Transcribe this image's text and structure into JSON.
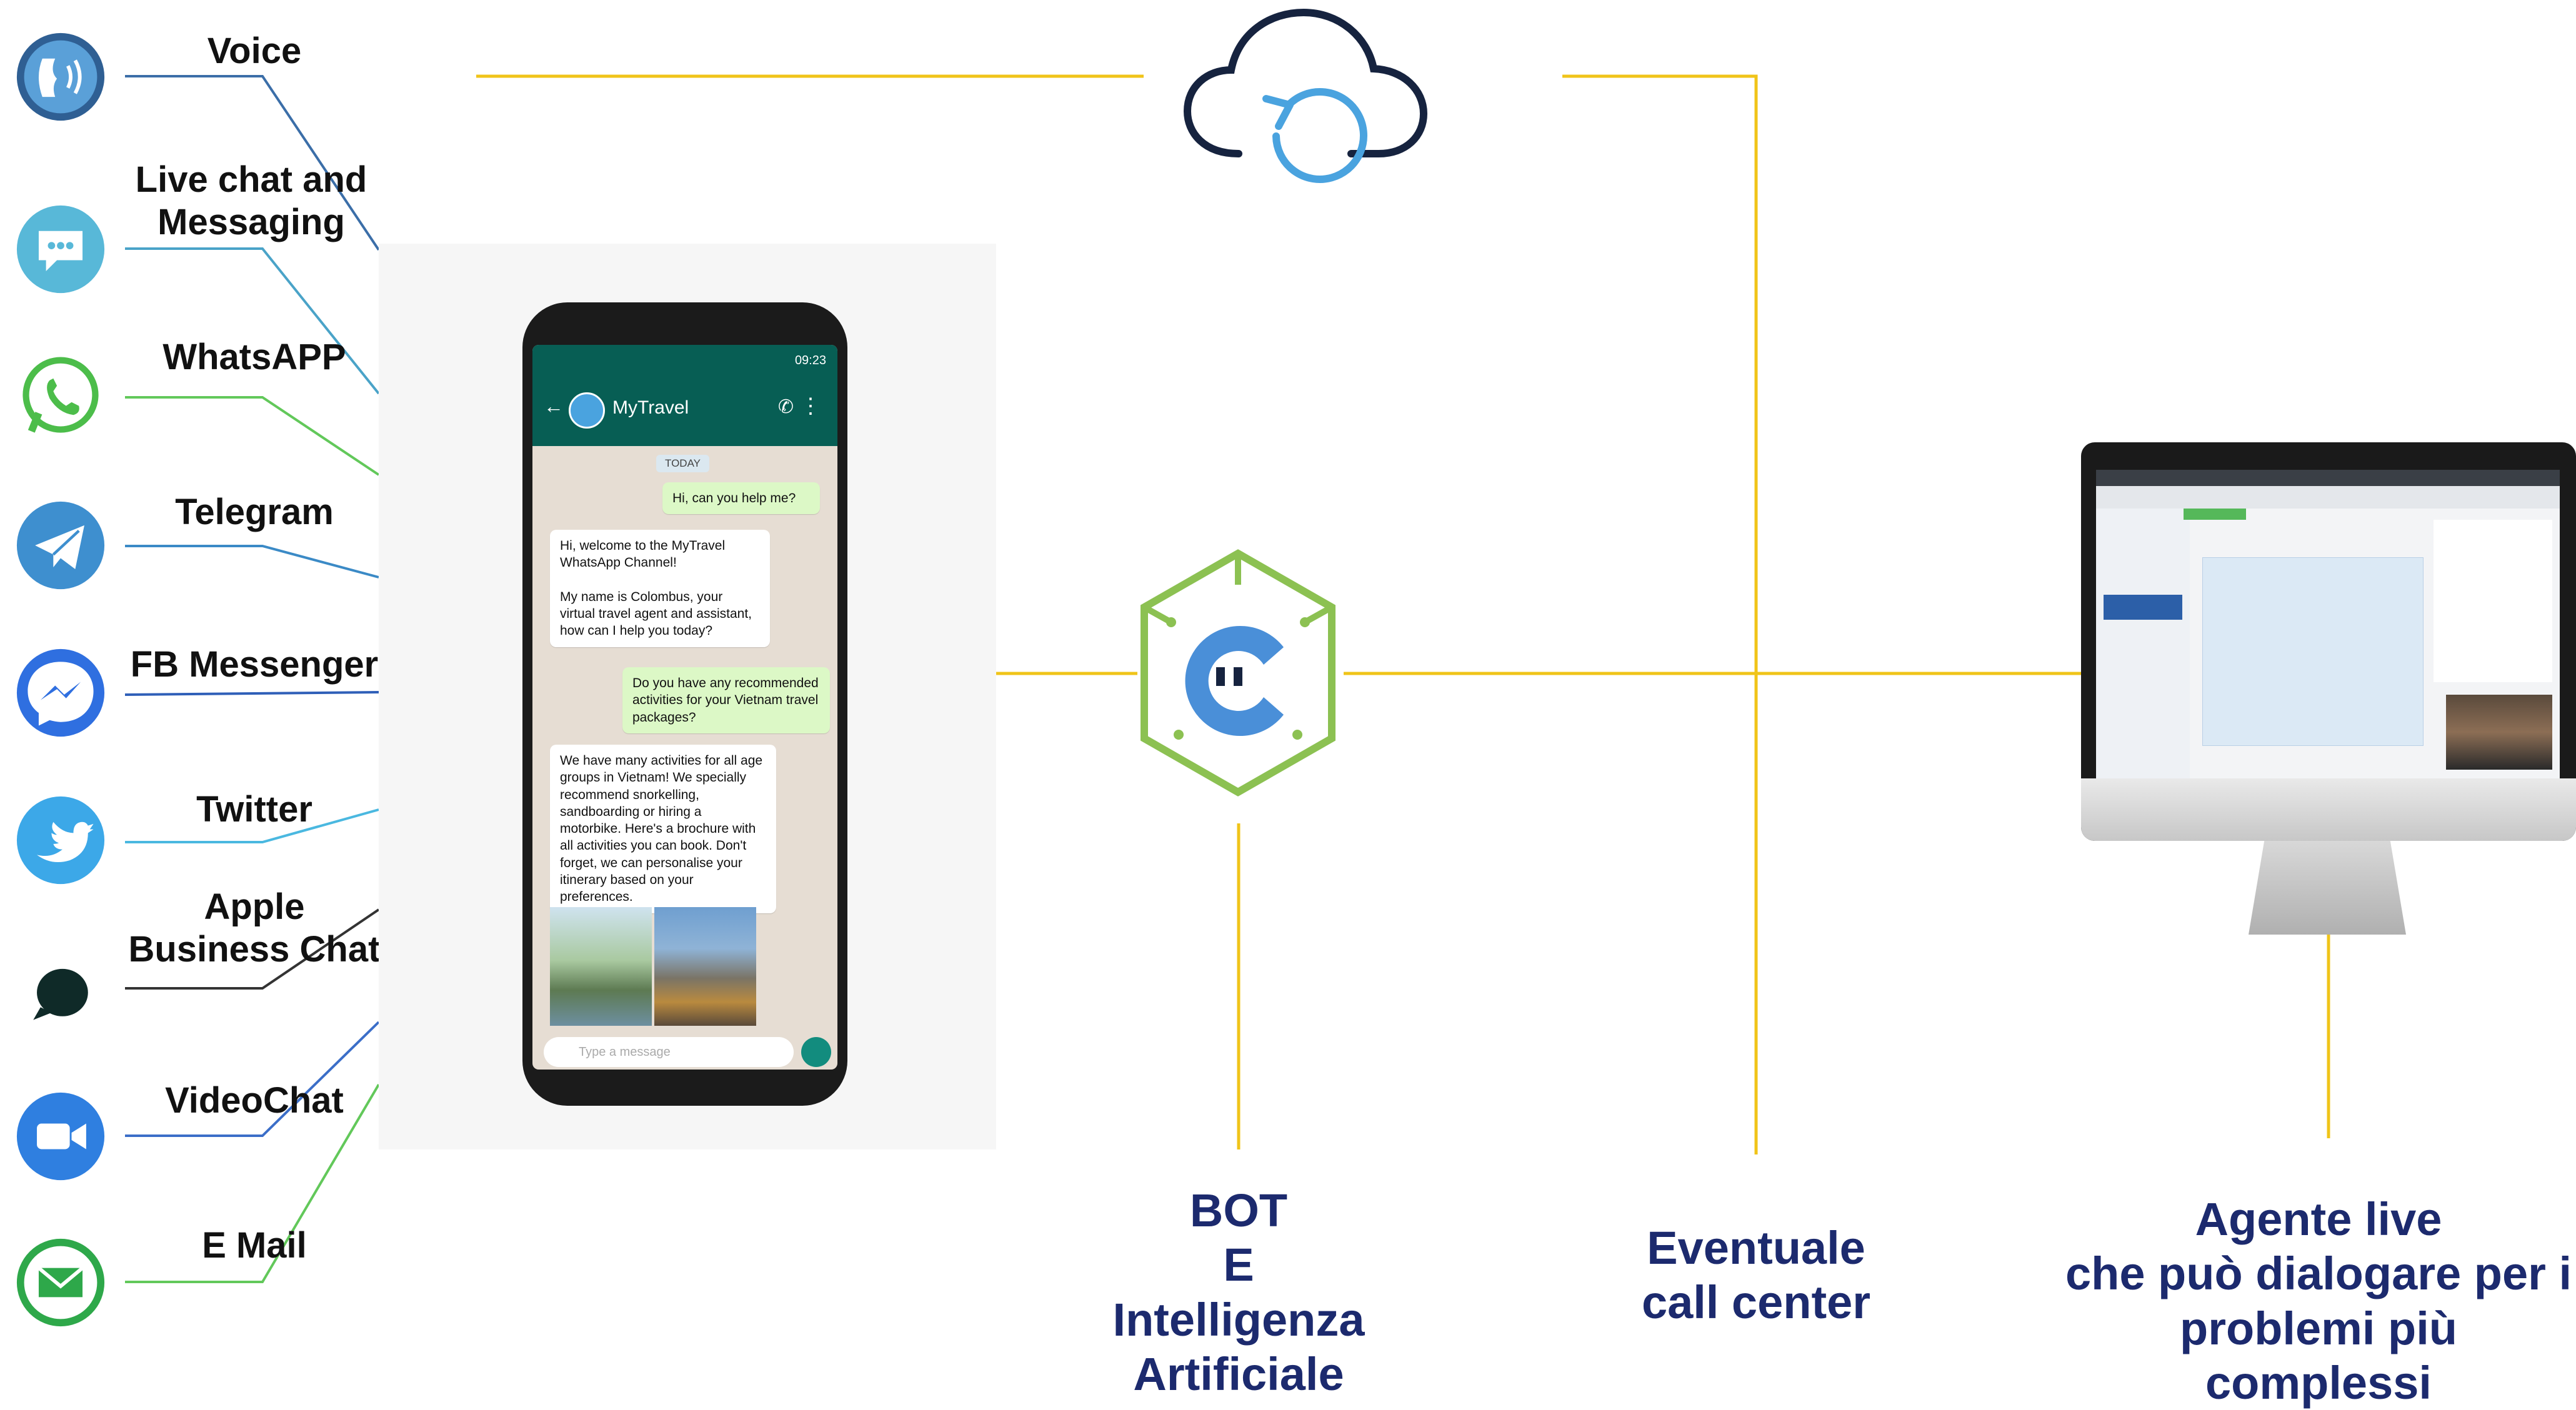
{
  "channels": [
    {
      "label": "Voice",
      "icon": "voice-icon"
    },
    {
      "label": "Live chat and Messaging",
      "icon": "chat-bubble-icon"
    },
    {
      "label": "WhatsAPP",
      "icon": "whatsapp-icon"
    },
    {
      "label": "Telegram",
      "icon": "telegram-icon"
    },
    {
      "label": "FB Messenger",
      "icon": "messenger-icon"
    },
    {
      "label": "Twitter",
      "icon": "twitter-icon"
    },
    {
      "label": "Apple Business Chat",
      "icon": "apple-business-chat-icon"
    },
    {
      "label": "VideoChat",
      "icon": "video-camera-icon"
    },
    {
      "label": "E Mail",
      "icon": "email-icon"
    }
  ],
  "nodes": {
    "bot": {
      "line1": "BOT",
      "line2": "E",
      "line3": "Intelligenza",
      "line4": "Artificiale"
    },
    "call_center": {
      "line1": "Eventuale",
      "line2": "call center"
    },
    "agent": {
      "line1": "Agente live",
      "line2": "che può dialogare per i",
      "line3": "problemi più complessi"
    }
  },
  "phone": {
    "time": "09:23",
    "app_name": "MyTravel",
    "date_divider": "TODAY",
    "messages": [
      {
        "dir": "out",
        "text": "Hi, can you help me?"
      },
      {
        "dir": "in",
        "text": "Hi, welcome to the MyTravel WhatsApp Channel!\n\nMy name is Colombus, your virtual travel agent and assistant, how can I help you today?"
      },
      {
        "dir": "out",
        "text": "Do you have any recommended activities for your Vietnam travel packages?"
      },
      {
        "dir": "in",
        "text": "We have many activities for all age groups in Vietnam! We specially recommend snorkelling, sandboarding or hiring a motorbike. Here's a brochure with all activities you can book. Don't forget, we can personalise your itinerary based on your preferences."
      }
    ],
    "input_placeholder": "Type a message"
  },
  "colors": {
    "connector": "#f0c419",
    "label_blue": "#1c2a6e",
    "logo_green": "#8cc152",
    "logo_blue": "#4a8fd8",
    "cloud_dark": "#16233f",
    "cloud_arrow": "#4aa3df",
    "whatsapp_header": "#075e54"
  }
}
